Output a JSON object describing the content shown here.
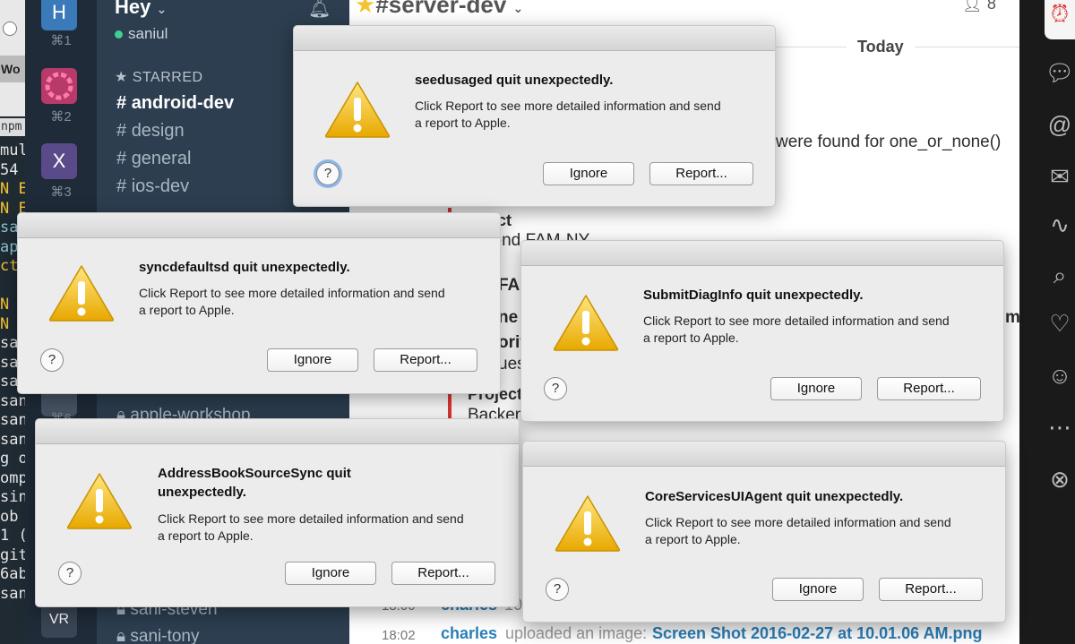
{
  "terminal": {
    "tab_label": "Wo",
    "npm_label": "npm",
    "lines": [
      "mul",
      "54",
      "N E",
      "N E",
      "san",
      "ap",
      "ct",
      "",
      "N",
      "N",
      "san",
      "san",
      "san",
      "san",
      "san",
      "san",
      "g o",
      "omp",
      "sin",
      " ob",
      "1 (",
      "git",
      "6ab",
      "san"
    ]
  },
  "workspaces": [
    {
      "letter": "H",
      "shortcut": "⌘1",
      "color": "#3a7ab8"
    },
    {
      "letter": "",
      "shortcut": "⌘2",
      "color": "#b83a6a"
    },
    {
      "letter": "X",
      "shortcut": "⌘3",
      "color": "#5a4a8a"
    },
    {
      "letter": "",
      "shortcut": "⌘6",
      "color": "#4a5566"
    },
    {
      "letter": "VR",
      "shortcut": "",
      "color": "#3a4555"
    }
  ],
  "sidebar": {
    "team_name": "Hey",
    "user": "saniul",
    "starred_label": "STARRED",
    "channels": [
      "android-dev",
      "design",
      "general",
      "ios-dev"
    ],
    "bottom_channels": [
      "apple-workshop",
      "sani-steven",
      "sani-tony"
    ]
  },
  "channel": {
    "title": "#server-dev",
    "member_count": "8",
    "today_label": "Today",
    "fragments": {
      "found": "were found for one_or_none()",
      "ject": "ject",
      "kend": "kend FAM-NY",
      "fa": "FA",
      "ne": "ne",
      "orit": "orit",
      "uest": "uest",
      "project": "Project",
      "backen": "Backen",
      "m": "m"
    },
    "messages": [
      {
        "time": "18:00",
        "author": "charles",
        "text": "10"
      },
      {
        "time": "18:02",
        "author": "charles",
        "text": "uploaded an image:",
        "link": "Screen Shot 2016-02-27 at 10.01.06 AM.png"
      }
    ]
  },
  "dialogs": [
    {
      "title": "seedusaged quit unexpectedly.",
      "message": "Click Report to see more detailed information and send a report to Apple.",
      "ignore": "Ignore",
      "report": "Report..."
    },
    {
      "title": "syncdefaultsd quit unexpectedly.",
      "message": "Click Report to see more detailed information and send a report to Apple.",
      "ignore": "Ignore",
      "report": "Report..."
    },
    {
      "title": "SubmitDiagInfo quit unexpectedly.",
      "message": "Click Report to see more detailed information and send a report to Apple.",
      "ignore": "Ignore",
      "report": "Report..."
    },
    {
      "title": "AddressBookSourceSync quit unexpectedly.",
      "message": "Click Report to see more detailed information and send a report to Apple.",
      "ignore": "Ignore",
      "report": "Report..."
    },
    {
      "title": "CoreServicesUIAgent quit unexpectedly.",
      "message": "Click Report to see more detailed information and send a report to Apple.",
      "ignore": "Ignore",
      "report": "Report..."
    }
  ],
  "help_glyph": "?",
  "colors": {
    "accent_red": "#e23636",
    "link_blue": "#2a80b9",
    "sidebar": "#2c3e50",
    "warning_yellow": "#f2c200"
  }
}
